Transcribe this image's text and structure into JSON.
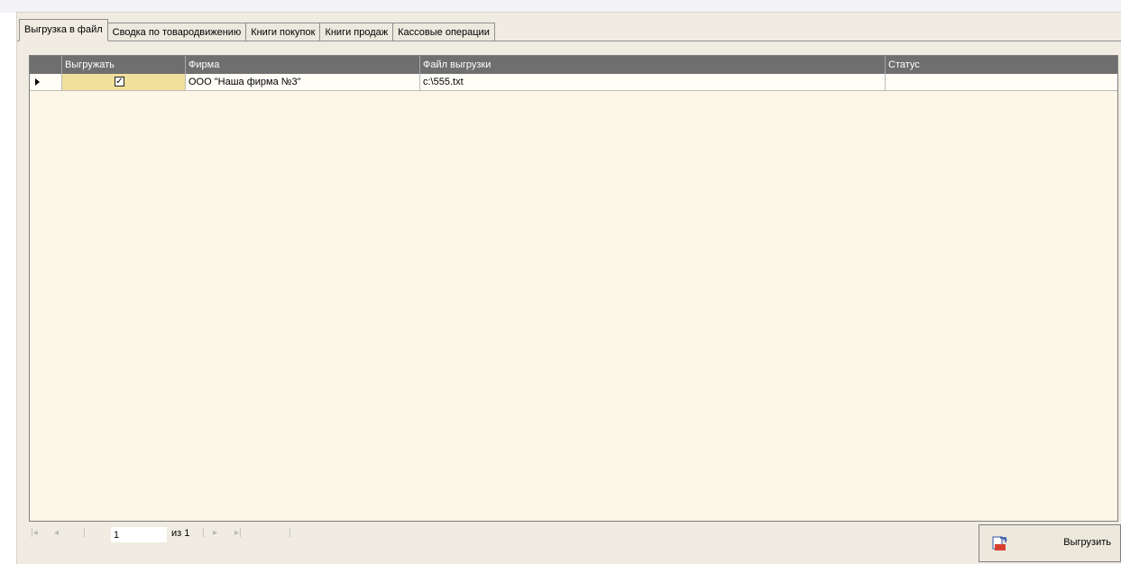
{
  "tabs": [
    {
      "label": "Выгрузка в файл",
      "active": true
    },
    {
      "label": "Сводка по товародвижению",
      "active": false
    },
    {
      "label": "Книги покупок",
      "active": false
    },
    {
      "label": "Книги продаж",
      "active": false
    },
    {
      "label": "Кассовые операции",
      "active": false
    }
  ],
  "grid": {
    "columns": [
      "Выгружать",
      "Фирма",
      "Файл выгрузки",
      "Статус"
    ],
    "rows": [
      {
        "export": true,
        "firm": "ООО \"Наша фирма №3\"",
        "file": "c:\\555.txt",
        "status": ""
      }
    ]
  },
  "pager": {
    "first_icon": "first-page-icon",
    "prev_icon": "prev-page-icon",
    "page_value": "1",
    "of_label": "из 1",
    "next_icon": "next-page-icon",
    "last_icon": "last-page-icon"
  },
  "export_button": {
    "label": "Выгрузить",
    "icon": "export-icon"
  },
  "colors": {
    "panel": "#f0ece1",
    "grid_bg": "#fcf6e7",
    "header": "#6f6f6f",
    "checkbox_cell": "#f1e09b"
  }
}
